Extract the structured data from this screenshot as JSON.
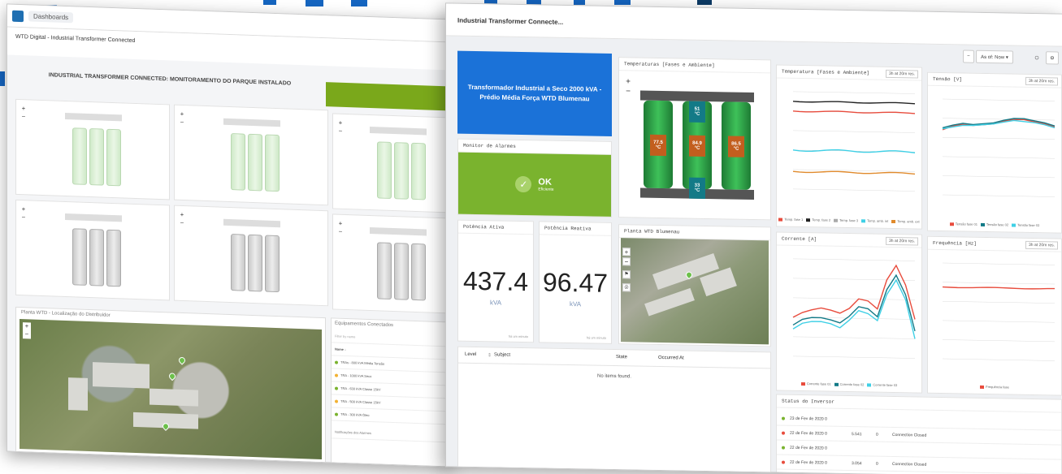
{
  "left": {
    "breadcrumb": "Dashboards",
    "subtitle": "WTD Digital - Industrial Transformer Connected",
    "heading": "INDUSTRIAL TRANSFORMER CONNECTED: MONITORAMENTO DO PARQUE INSTALADO",
    "map_title": "Planta WTD - Localização do Distribuidor",
    "equip_title": "Equipamentos Conectados",
    "filter_placeholder": "Filter by name",
    "name_col": "Name ↓",
    "alarm_title": "Notificações dos Alarmes",
    "rows": [
      "TRAs - 800 kVA Média Tensão",
      "TRA - 1000 kVA Seco",
      "TRA - 630 kVA Classe 15kV",
      "TRA - 500 kVA Classe 15kV",
      "TRA - 300 kVA Óleo"
    ]
  },
  "right": {
    "title": "Industrial Transformer Connecte...",
    "as_of": "As of: Now ▾",
    "blue_panel": "Transformador Industrial a Seco 2000 kVA - Prédio Média Força WTD Blumenau",
    "temp_panel_title": "Temperaturas [Fases e Ambiente]",
    "temp_values": {
      "top": "51",
      "left": "77.5",
      "mid": "84.9",
      "right": "86.5",
      "bottom": "33",
      "unit": "°C"
    },
    "alarm_monitor_title": "Monitor de Alarmes",
    "ok_text": "OK",
    "ok_sub": "Eficiente",
    "active_power": {
      "title": "Potência Ativa",
      "value": "437.4",
      "unit": "kVA",
      "note": "há um minuto"
    },
    "reactive_power": {
      "title": "Potência Reativa",
      "value": "96.47",
      "unit": "kVA",
      "note": "há um minuto"
    },
    "plant_map_title": "Planta WTD Blumenau",
    "chart_temp_title": "Temperatura [Fases e Ambiente]",
    "chart_voltage_title": "Tensão [V]",
    "chart_current_title": "Corrente [A]",
    "chart_freq_title": "Frequência [Hz]",
    "range_btn": "3h at 20m res.",
    "alarm_table": {
      "level": "Level",
      "subject": "Subject",
      "state": "State",
      "occurred": "Occurred At",
      "empty": "No items found."
    },
    "status_title": "Status do Inversor",
    "status_rows": [
      {
        "date": "23 de Fev de 2020 0",
        "a": "",
        "b": "",
        "c": ""
      },
      {
        "date": "22 de Fev de 2020 0",
        "a": "5.541",
        "b": "0",
        "c": "Connection Closed"
      },
      {
        "date": "22 de Fev de 2020 0",
        "a": "",
        "b": "",
        "c": ""
      },
      {
        "date": "22 de Fev de 2020 0",
        "a": "3.054",
        "b": "0",
        "c": "Connection Closed"
      }
    ],
    "legend_temp": [
      "Temp. fase 1",
      "Temp. fase 2",
      "Temp. fase 3",
      "Temp. amb. int",
      "Temp. amb. ext"
    ],
    "legend_voltage": [
      "Tensão fase 01",
      "Tensão fase 02",
      "Tensão fase 03"
    ],
    "legend_current": [
      "Corrente fase 01",
      "Corrente fase 02",
      "Corrente fase 03"
    ],
    "legend_freq": [
      "Frequência fase"
    ]
  },
  "colors": {
    "blue": "#1b72d8",
    "green": "#7ab32e",
    "red": "#e84c3d",
    "teal": "#137a87",
    "cyan": "#3fd0e6",
    "orange": "#e08a2c"
  }
}
